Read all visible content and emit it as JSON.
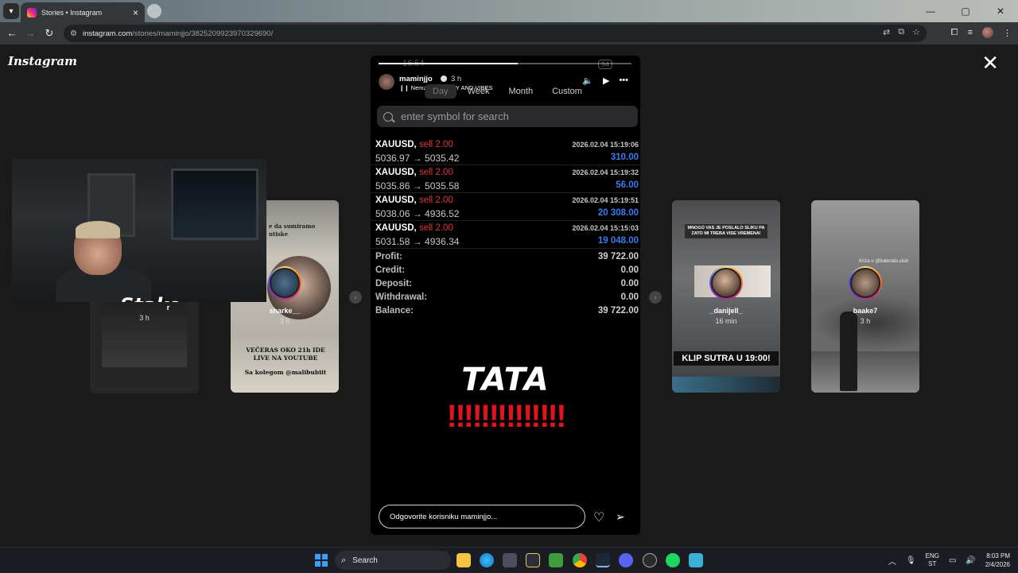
{
  "browser": {
    "tab_title": "Stories • Instagram",
    "url_host": "instagram.com",
    "url_path": "/stories/maminjjo/3825209923970329690/"
  },
  "page": {
    "logo": "Instagram"
  },
  "side_stories": [
    {
      "user": "sharke__",
      "time": "3 h",
      "caption_top": "e da sumiramo utiske",
      "caption_bottom": "VEČERAS OKO 21h IDE LIVE NA YOUTUBE",
      "caption_small": "Sa kolegom @malibubiit"
    },
    {
      "user": "_danijell_",
      "time": "16 min",
      "caption_top": "MNOGO VAS JE POSLALO SLIKU PA ZATO MI TREBA VISE VREMENA!",
      "caption_bottom": "KLIP SUTRA U 19:00!"
    },
    {
      "user": "baake7",
      "time": "3 h",
      "caption_top": "Kriza u @balevato.club"
    },
    {
      "user_partial": "r",
      "time": "3 h"
    }
  ],
  "webcam": {
    "brand": "Stake"
  },
  "story": {
    "user": "maminjjo",
    "time": "3 h",
    "music": "Nemzzz · MONEY AND VIBES",
    "status_time": "16:54",
    "battery": "94",
    "progress": 0.55,
    "tabs": [
      "Day",
      "Week",
      "Month",
      "Custom"
    ],
    "active_tab": "Day",
    "search_placeholder": "enter symbol for search",
    "trades": [
      {
        "symbol": "XAUUSD,",
        "action": "sell 2.00",
        "date": "2026.02.04 15:19:06",
        "prices": "5036.97 → 5035.42",
        "profit": "310.00"
      },
      {
        "symbol": "XAUUSD,",
        "action": "sell 2.00",
        "date": "2026.02.04 15:19:32",
        "prices": "5035.86 → 5035.58",
        "profit": "56.00"
      },
      {
        "symbol": "XAUUSD,",
        "action": "sell 2.00",
        "date": "2026.02.04 15:19:51",
        "prices": "5038.06 → 4936.52",
        "profit": "20 308.00"
      },
      {
        "symbol": "XAUUSD,",
        "action": "sell 2.00",
        "date": "2026.02.04 15:15:03",
        "prices": "5031.58 → 4936.34",
        "profit": "19 048.00"
      }
    ],
    "summary": [
      {
        "label": "Profit:",
        "value": "39 722.00"
      },
      {
        "label": "Credit:",
        "value": "0.00"
      },
      {
        "label": "Deposit:",
        "value": "0.00"
      },
      {
        "label": "Withdrawal:",
        "value": "0.00"
      },
      {
        "label": "Balance:",
        "value": "39 722.00"
      }
    ],
    "big_text": "TATA",
    "bangs": "‼‼‼‼‼‼‼",
    "reply_placeholder": "Odgovorite korisniku maminjjo..."
  },
  "taskbar": {
    "search_label": "Search",
    "lang_top": "ENG",
    "lang_bottom": "ST",
    "clock_time": "8:03 PM",
    "clock_date": "2/4/2026"
  },
  "colors": {
    "sell": "#e0323c",
    "profit": "#3a7cf0",
    "bangs": "#e0141e"
  }
}
